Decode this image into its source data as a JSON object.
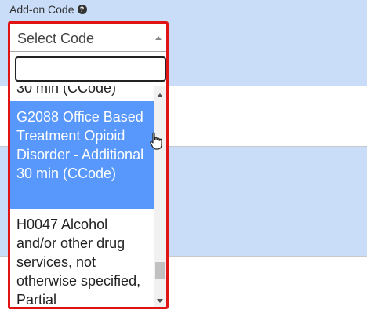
{
  "field": {
    "label": "Add-on Code",
    "help_icon_glyph": "?"
  },
  "select": {
    "value": "Select Code",
    "search_value": "",
    "scroll_position_fraction": 0.86,
    "options": [
      {
        "label": "30 min (CCode)",
        "state": "partially-visible"
      },
      {
        "label": "G2088 Office Based Treatment Opioid Disorder - Additional 30 min (CCode)",
        "state": "highlighted"
      },
      {
        "label": "H0047 Alcohol and/or other drug services, not otherwise specified, Partial",
        "state": "normal"
      }
    ]
  },
  "icons": {
    "help": "question-circle-icon",
    "dropdown": "chevron-up-icon",
    "cursor": "hand-pointer-icon"
  },
  "colors": {
    "highlight": "#5897fb",
    "annotation_border": "#e11414",
    "table_band": "#c9dcf8"
  }
}
